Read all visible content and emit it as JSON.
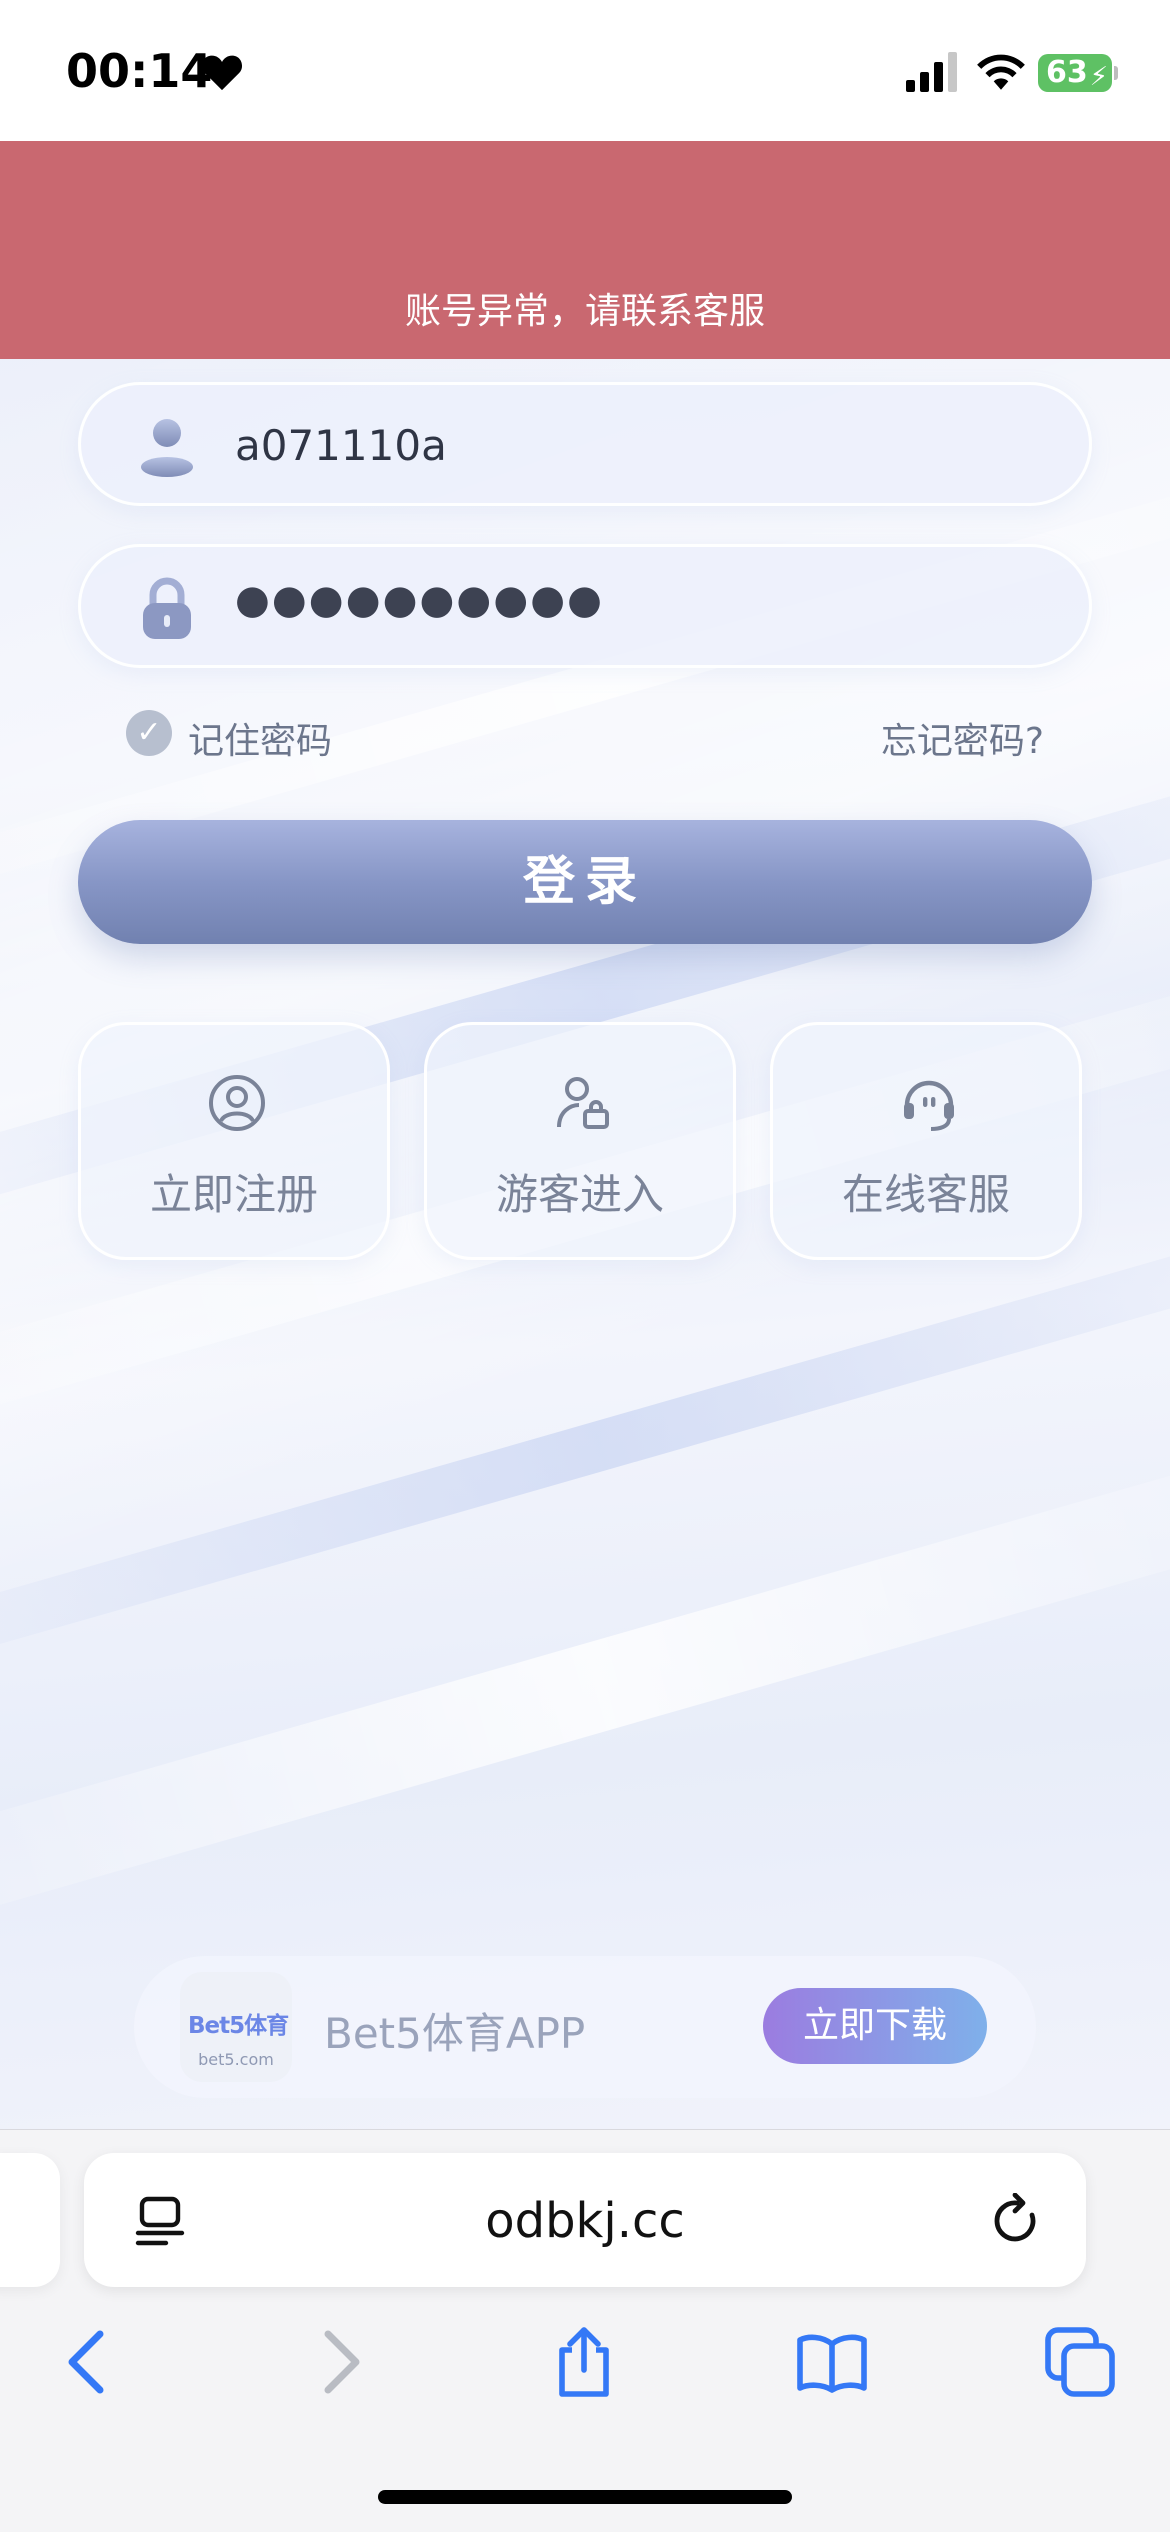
{
  "status_bar": {
    "time": "00:14",
    "battery": "63"
  },
  "alert": {
    "message": "账号异常，请联系客服"
  },
  "login_form": {
    "username_value": "a071110a",
    "password_mask": "●●●●●●●●●●",
    "remember_label": "记住密码",
    "remember_checked": true,
    "forgot_label": "忘记密码?",
    "login_label": "登录"
  },
  "actions": [
    {
      "label": "立即注册",
      "icon": "user-circle-icon"
    },
    {
      "label": "游客进入",
      "icon": "guest-user-icon"
    },
    {
      "label": "在线客服",
      "icon": "headset-icon"
    }
  ],
  "app_banner": {
    "logo_text": "Bet5体育",
    "logo_domain": "bet5.com",
    "app_name": "Bet5体育APP",
    "download_label": "立即下载"
  },
  "browser": {
    "url": "odbkj.cc",
    "icons": [
      "reader-icon",
      "reload-icon",
      "back-icon",
      "forward-icon",
      "share-icon",
      "bookmarks-icon",
      "tabs-icon"
    ]
  },
  "colors": {
    "alert_bg": "#c96870",
    "login_button": "#8796c6",
    "download_gradient_start": "#9b7ce0",
    "download_gradient_end": "#7fb0ea",
    "safari_blue": "#3478f6"
  }
}
